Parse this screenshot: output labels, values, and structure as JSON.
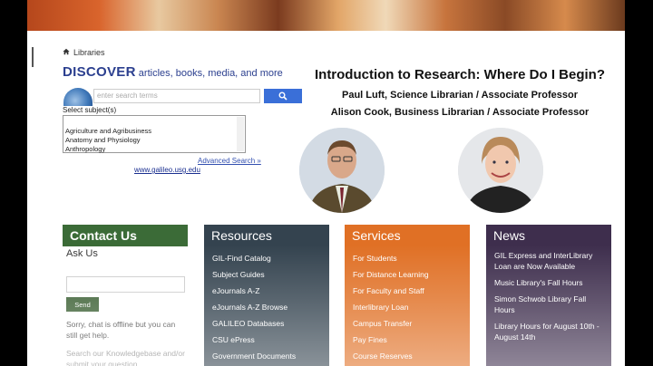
{
  "breadcrumb": {
    "label": "Libraries"
  },
  "discover": {
    "heading": "DISCOVER",
    "tagline": " articles, books, media, and more",
    "search_placeholder": "enter search terms",
    "select_label": "Select subject(s)",
    "subjects": [
      "Agriculture and Agribusiness",
      "Anatomy and Physiology",
      "Anthropology"
    ],
    "advanced_link": "Advanced Search »",
    "galileo_link": "www.galileo.usg.edu"
  },
  "intro": {
    "title": "Introduction to Research: Where Do I Begin?",
    "presenter1": "Paul Luft, Science Librarian / Associate Professor",
    "presenter2": "Alison Cook, Business Librarian / Associate Professor"
  },
  "contact": {
    "heading": "Contact Us",
    "ask_label": "Ask Us",
    "send_label": "Send",
    "offline_msg": "Sorry, chat is offline but you can still get help.",
    "kb_msg": "Search our Knowledgebase and/or submit your question."
  },
  "resources": {
    "heading": "Resources",
    "items": [
      "GIL-Find Catalog",
      "Subject Guides",
      "eJournals A-Z",
      "eJournals A-Z Browse",
      "GALILEO Databases",
      "CSU ePress",
      "Government Documents"
    ]
  },
  "services": {
    "heading": "Services",
    "items": [
      "For Students",
      "For Distance Learning",
      "For Faculty and Staff",
      "Interlibrary Loan",
      "Campus Transfer",
      "Pay Fines",
      "Course Reserves"
    ]
  },
  "news": {
    "heading": "News",
    "items": [
      "GIL Express and InterLibrary Loan are Now Available",
      "Music Library's Fall Hours",
      "Simon Schwob Library Fall Hours",
      "Library Hours for August 10th - August 14th"
    ]
  },
  "colors": {
    "contact": "#3b6b37",
    "resources": "#34434f",
    "services": "#e07025",
    "news": "#3e2e4d",
    "discover": "#2b3f8f"
  }
}
